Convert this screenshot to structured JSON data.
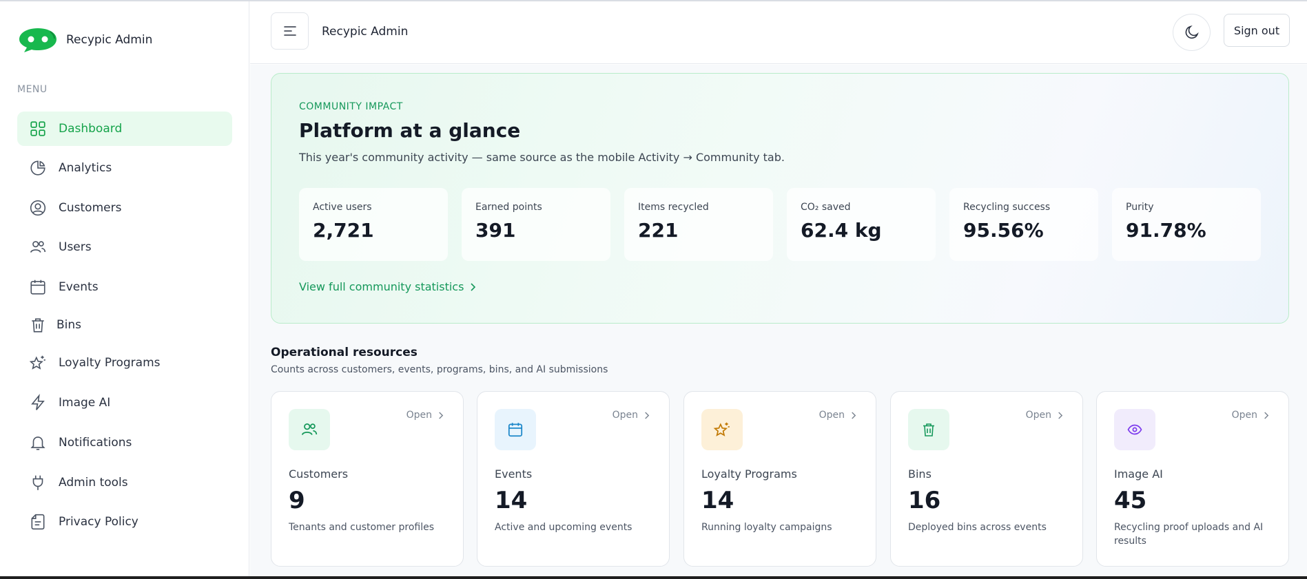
{
  "app": {
    "name": "Recypic Admin"
  },
  "sidebar": {
    "menu_label": "MENU",
    "items": [
      {
        "label": "Dashboard",
        "icon": "dashboard-grid-icon",
        "active": true
      },
      {
        "label": "Analytics",
        "icon": "pie-chart-icon"
      },
      {
        "label": "Customers",
        "icon": "user-circle-icon"
      },
      {
        "label": "Users",
        "icon": "users-icon"
      },
      {
        "label": "Events",
        "icon": "calendar-icon"
      },
      {
        "label": "Bins",
        "icon": "trash-bin-icon"
      },
      {
        "label": "Loyalty Programs",
        "icon": "star-sparkle-icon"
      },
      {
        "label": "Image AI",
        "icon": "lightning-icon"
      },
      {
        "label": "Notifications",
        "icon": "bell-icon"
      },
      {
        "label": "Admin tools",
        "icon": "plug-icon"
      },
      {
        "label": "Privacy Policy",
        "icon": "document-icon"
      }
    ]
  },
  "header": {
    "title": "Recypic Admin",
    "sign_out": "Sign out"
  },
  "impact": {
    "kicker": "COMMUNITY IMPACT",
    "title": "Platform at a glance",
    "description": "This year's community activity — same source as the mobile Activity → Community tab.",
    "stats": [
      {
        "label": "Active users",
        "value": "2,721"
      },
      {
        "label": "Earned points",
        "value": "391"
      },
      {
        "label": "Items recycled",
        "value": "221"
      },
      {
        "label": "CO₂ saved",
        "value": "62.4 kg"
      },
      {
        "label": "Recycling success",
        "value": "95.56%"
      },
      {
        "label": "Purity",
        "value": "91.78%"
      }
    ],
    "link": "View full community statistics"
  },
  "ops": {
    "title": "Operational resources",
    "description": "Counts across customers, events, programs, bins, and AI submissions",
    "open_label": "Open",
    "cards": [
      {
        "name": "Customers",
        "count": "9",
        "description": "Tenants and customer profiles",
        "icon": "users-icon"
      },
      {
        "name": "Events",
        "count": "14",
        "description": "Active and upcoming events",
        "icon": "calendar-icon"
      },
      {
        "name": "Loyalty Programs",
        "count": "14",
        "description": "Running loyalty campaigns",
        "icon": "star-sparkle-icon"
      },
      {
        "name": "Bins",
        "count": "16",
        "description": "Deployed bins across events",
        "icon": "trash-bin-icon"
      },
      {
        "name": "Image AI",
        "count": "45",
        "description": "Recycling proof uploads and AI results",
        "icon": "eye-icon"
      }
    ]
  },
  "colors": {
    "accent": "#15a34a",
    "accent_soft": "#e8faee",
    "customers_tile": "#e6f8ee",
    "events_tile": "#e8f4fd",
    "loyalty_tile": "#fdf0d8",
    "bins_tile": "#e6f8ee",
    "image_ai_tile": "#f1ecfc"
  }
}
